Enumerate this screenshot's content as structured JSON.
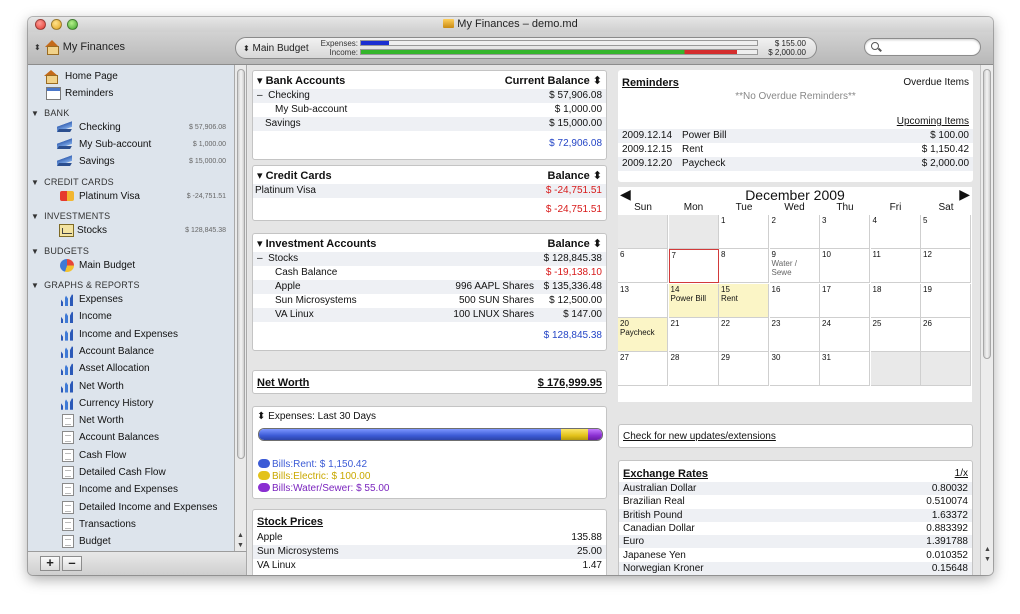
{
  "window": {
    "title": "My Finances – demo.md"
  },
  "toolbar": {
    "account_selector": "My Finances",
    "budget_label": "Main Budget",
    "expenses_label": "Expenses:",
    "income_label": "Income:",
    "expenses_amount": "$ 155.00",
    "income_amount": "$ 2,000.00",
    "expenses_fraction": 0.07,
    "income_fraction": 0.95,
    "search_placeholder": ""
  },
  "sidebar": {
    "home": "Home Page",
    "reminders": "Reminders",
    "sections": {
      "bank": "BANK",
      "credit": "CREDIT CARDS",
      "investments": "INVESTMENTS",
      "budgets": "BUDGETS",
      "reports": "GRAPHS & REPORTS"
    },
    "bank_items": [
      {
        "label": "Checking",
        "amount": "$ 57,906.08"
      },
      {
        "label": "My Sub-account",
        "amount": "$ 1,000.00"
      },
      {
        "label": "Savings",
        "amount": "$ 15,000.00"
      }
    ],
    "credit_items": [
      {
        "label": "Platinum Visa",
        "amount": "$ -24,751.51"
      }
    ],
    "investment_items": [
      {
        "label": "Stocks",
        "amount": "$ 128,845.38"
      }
    ],
    "budget_items": [
      {
        "label": "Main Budget"
      }
    ],
    "graphs": [
      "Expenses",
      "Income",
      "Income and Expenses",
      "Account Balance",
      "Asset Allocation",
      "Net Worth",
      "Currency History"
    ],
    "reports": [
      "Net Worth",
      "Account Balances",
      "Cash Flow",
      "Detailed Cash Flow",
      "Income and Expenses",
      "Detailed Income and Expenses",
      "Transactions",
      "Budget"
    ]
  },
  "bank_accounts": {
    "title": "Bank Accounts",
    "col": "Current Balance",
    "rows": [
      {
        "name": "Checking",
        "prefix": "–",
        "amount": "$ 57,906.08"
      },
      {
        "name": "My Sub-account",
        "amount": "$ 1,000.00"
      },
      {
        "name": "Savings",
        "amount": "$ 15,000.00"
      }
    ],
    "total": "$ 72,906.08"
  },
  "credit_cards": {
    "title": "Credit Cards",
    "col": "Balance",
    "rows": [
      {
        "name": "Platinum Visa",
        "amount": "$ -24,751.51"
      }
    ],
    "total": "$ -24,751.51"
  },
  "investments": {
    "title": "Investment Accounts",
    "col": "Balance",
    "rows": [
      {
        "name": "Stocks",
        "prefix": "–",
        "shares": "",
        "amount": "$ 128,845.38"
      },
      {
        "name": "Cash Balance",
        "shares": "",
        "amount": "$ -19,138.10"
      },
      {
        "name": "Apple",
        "shares": "996 AAPL Shares",
        "amount": "$ 135,336.48"
      },
      {
        "name": "Sun Microsystems",
        "shares": "500 SUN Shares",
        "amount": "$ 12,500.00"
      },
      {
        "name": "VA Linux",
        "shares": "100 LNUX Shares",
        "amount": "$ 147.00"
      }
    ],
    "total": "$ 128,845.38"
  },
  "net_worth": {
    "label": "Net Worth",
    "amount": "$ 176,999.95"
  },
  "expenses_widget": {
    "title": "Expenses: Last 30 Days",
    "fractions": {
      "rent": 0.887,
      "electric": 0.077,
      "water": 0.042
    },
    "legend": [
      {
        "label": "Bills:Rent: $ 1,150.42",
        "color": "#3c5bd6"
      },
      {
        "label": "Bills:Electric: $ 100.00",
        "color": "#e3c21a"
      },
      {
        "label": "Bills:Water/Sewer: $ 55.00",
        "color": "#8a2fd1"
      }
    ]
  },
  "stock_prices": {
    "title": "Stock Prices",
    "rows": [
      {
        "name": "Apple",
        "price": "135.88"
      },
      {
        "name": "Sun Microsystems",
        "price": "25.00"
      },
      {
        "name": "VA Linux",
        "price": "1.47"
      }
    ]
  },
  "reminders": {
    "title": "Reminders",
    "overdue_label": "Overdue Items",
    "no_overdue": "**No Overdue Reminders**",
    "upcoming_label": "Upcoming Items",
    "items": [
      {
        "date": "2009.12.14",
        "name": "Power Bill",
        "amount": "$ 100.00"
      },
      {
        "date": "2009.12.15",
        "name": "Rent",
        "amount": "$ 1,150.42"
      },
      {
        "date": "2009.12.20",
        "name": "Paycheck",
        "amount": "$ 2,000.00"
      }
    ]
  },
  "calendar": {
    "title": "December 2009",
    "days": [
      "Sun",
      "Mon",
      "Tue",
      "Wed",
      "Thu",
      "Fri",
      "Sat"
    ],
    "cells": [
      {
        "d": "",
        "out": true
      },
      {
        "d": "",
        "out": true
      },
      {
        "d": "1"
      },
      {
        "d": "2"
      },
      {
        "d": "3"
      },
      {
        "d": "4"
      },
      {
        "d": "5"
      },
      {
        "d": "6"
      },
      {
        "d": "7",
        "today": true
      },
      {
        "d": "8"
      },
      {
        "d": "9",
        "ev": "Water / Sewe",
        "gray": true
      },
      {
        "d": "10"
      },
      {
        "d": "11"
      },
      {
        "d": "12"
      },
      {
        "d": "13"
      },
      {
        "d": "14",
        "ev": "Power Bill",
        "event": true
      },
      {
        "d": "15",
        "ev": "Rent",
        "event": true
      },
      {
        "d": "16"
      },
      {
        "d": "17"
      },
      {
        "d": "18"
      },
      {
        "d": "19"
      },
      {
        "d": "20",
        "ev": "Paycheck",
        "event": true
      },
      {
        "d": "21"
      },
      {
        "d": "22"
      },
      {
        "d": "23"
      },
      {
        "d": "24"
      },
      {
        "d": "25"
      },
      {
        "d": "26"
      },
      {
        "d": "27"
      },
      {
        "d": "28"
      },
      {
        "d": "29"
      },
      {
        "d": "30"
      },
      {
        "d": "31"
      },
      {
        "d": "",
        "out": true
      },
      {
        "d": "",
        "out": true
      }
    ]
  },
  "updates": {
    "link": "Check for new updates/extensions"
  },
  "exchange_rates": {
    "title": "Exchange Rates",
    "col": "1/x",
    "rows": [
      {
        "name": "Australian Dollar",
        "rate": "0.80032"
      },
      {
        "name": "Brazilian Real",
        "rate": "0.510074"
      },
      {
        "name": "British Pound",
        "rate": "1.63372"
      },
      {
        "name": "Canadian Dollar",
        "rate": "0.883392"
      },
      {
        "name": "Euro",
        "rate": "1.391788"
      },
      {
        "name": "Japanese Yen",
        "rate": "0.010352"
      },
      {
        "name": "Norwegian Kroner",
        "rate": "0.15648"
      }
    ]
  },
  "colors": {
    "accent_blue": "#2546c6",
    "negative_red": "#d81b1b",
    "sidebar_bg": "#dde4ec",
    "income_green": "#35b52c"
  }
}
